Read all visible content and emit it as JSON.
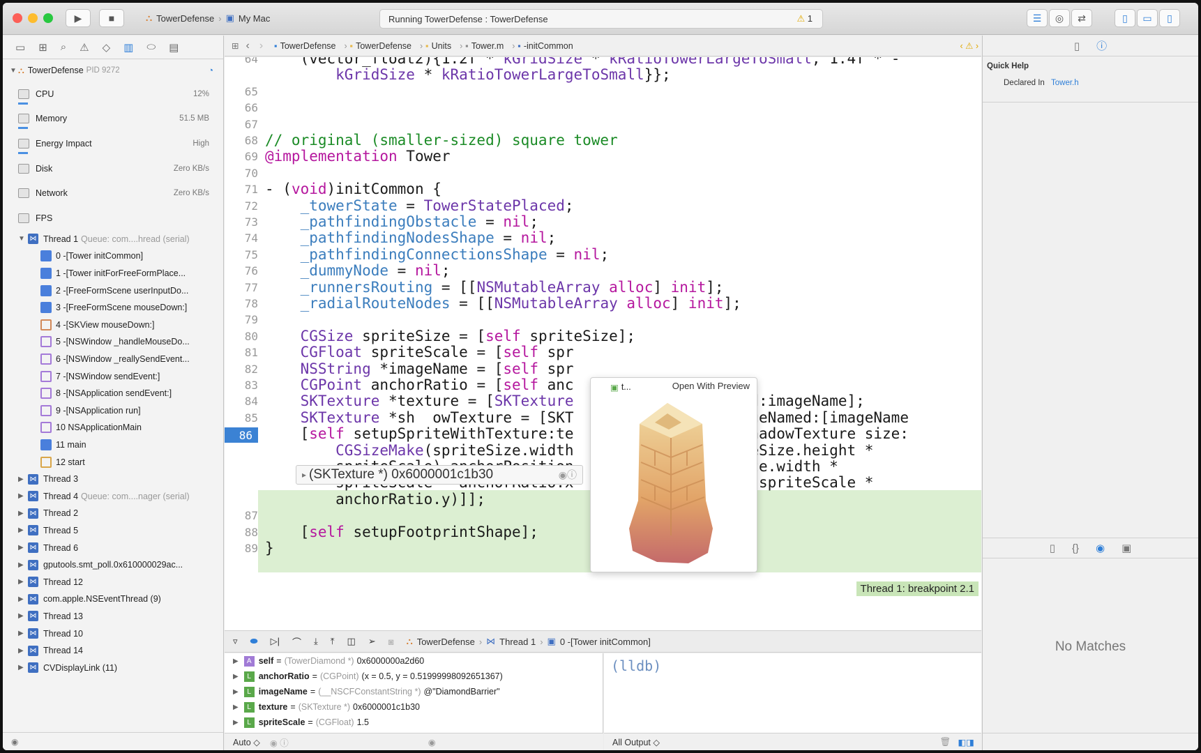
{
  "toolbar": {
    "scheme_name": "TowerDefense",
    "destination": "My Mac",
    "activity_text": "Running TowerDefense : TowerDefense",
    "warning_count": "1"
  },
  "navigator": {
    "process_name": "TowerDefense",
    "pid": "PID 9272",
    "gauges": [
      {
        "label": "CPU",
        "value": "12%"
      },
      {
        "label": "Memory",
        "value": "51.5 MB"
      },
      {
        "label": "Energy Impact",
        "value": "High"
      },
      {
        "label": "Disk",
        "value": "Zero KB/s"
      },
      {
        "label": "Network",
        "value": "Zero KB/s"
      },
      {
        "label": "FPS",
        "value": ""
      }
    ],
    "thread1": {
      "label": "Thread 1",
      "queue": "Queue: com....hread (serial)"
    },
    "frames": [
      "0 -[Tower initCommon]",
      "1 -[Tower initForFreeFormPlace...",
      "2 -[FreeFormScene userInputDo...",
      "3 -[FreeFormScene mouseDown:]",
      "4 -[SKView mouseDown:]",
      "5 -[NSWindow _handleMouseDo...",
      "6 -[NSWindow _reallySendEvent...",
      "7 -[NSWindow sendEvent:]",
      "8 -[NSApplication sendEvent:]",
      "9 -[NSApplication run]",
      "10 NSApplicationMain",
      "11 main",
      "12 start"
    ],
    "threads": [
      {
        "label": "Thread 3",
        "queue": ""
      },
      {
        "label": "Thread 4",
        "queue": "Queue: com....nager (serial)"
      },
      {
        "label": "Thread 2",
        "queue": ""
      },
      {
        "label": "Thread 5",
        "queue": ""
      },
      {
        "label": "Thread 6",
        "queue": ""
      },
      {
        "label": "gputools.smt_poll.0x610000029ac...",
        "queue": ""
      },
      {
        "label": "Thread 12",
        "queue": ""
      },
      {
        "label": "com.apple.NSEventThread (9)",
        "queue": ""
      },
      {
        "label": "Thread 13",
        "queue": ""
      },
      {
        "label": "Thread 10",
        "queue": ""
      },
      {
        "label": "Thread 14",
        "queue": ""
      },
      {
        "label": "CVDisplayLink (11)",
        "queue": ""
      }
    ]
  },
  "jumpbar": {
    "crumbs": [
      "TowerDefense",
      "TowerDefense",
      "Units",
      "Tower.m",
      "-initCommon"
    ]
  },
  "editor": {
    "lines": [
      {
        "n": "64",
        "t": "    (vector_float2){1.2f * kGridSize * kRatioTowerLargeToSmall, 1.4f * -"
      },
      {
        "n": "",
        "t": "        kGridSize * kRatioTowerLargeToSmall}};"
      },
      {
        "n": "65",
        "t": ""
      },
      {
        "n": "66",
        "t": ""
      },
      {
        "n": "67",
        "t": ""
      },
      {
        "n": "68",
        "t": "// original (smaller-sized) square tower"
      },
      {
        "n": "69",
        "t": "@implementation Tower"
      },
      {
        "n": "70",
        "t": ""
      },
      {
        "n": "71",
        "t": "- (void)initCommon {"
      },
      {
        "n": "72",
        "t": "    _towerState = TowerStatePlaced;"
      },
      {
        "n": "73",
        "t": "    _pathfindingObstacle = nil;"
      },
      {
        "n": "74",
        "t": "    _pathfindingNodesShape = nil;"
      },
      {
        "n": "75",
        "t": "    _pathfindingConnectionsShape = nil;"
      },
      {
        "n": "76",
        "t": "    _dummyNode = nil;"
      },
      {
        "n": "77",
        "t": "    _runnersRouting = [[NSMutableArray alloc] init];"
      },
      {
        "n": "78",
        "t": "    _radialRouteNodes = [[NSMutableArray alloc] init];"
      },
      {
        "n": "79",
        "t": ""
      },
      {
        "n": "80",
        "t": "    CGSize spriteSize = [self spriteSize];"
      },
      {
        "n": "81",
        "t": "    CGFloat spriteScale = [self spr"
      },
      {
        "n": "82",
        "t": "    NSString *imageName = [self spr"
      },
      {
        "n": "83",
        "t": "    CGPoint anchorRatio = [self anc"
      },
      {
        "n": "84",
        "t": "    SKTexture *texture = [SKTexture                 amed:imageName];"
      },
      {
        "n": "85",
        "t": "    SKTexture *sh  owTexture = [SKT                 ImageNamed:[imageName"
      },
      {
        "n": "86",
        "t": "    [self setupSpriteWithTexture:te                 e:shadowTexture size:"
      },
      {
        "n": "",
        "t": "        CGSizeMake(spriteSize.width                 riteSize.height *"
      },
      {
        "n": "",
        "t": "        spriteScale) anchorPosition                 eSize.width *"
      },
      {
        "n": "",
        "t": "        spriteScale * anchorRatio.x                 t * spriteScale *"
      },
      {
        "n": "",
        "t": "        anchorRatio.y)]];"
      },
      {
        "n": "87",
        "t": ""
      },
      {
        "n": "88",
        "t": "    [self setupFootprintShape];"
      },
      {
        "n": "89",
        "t": "}"
      }
    ],
    "breakpoint_label": "Thread 1: breakpoint 2.1",
    "tooltip": "(SKTexture *) 0x6000001c1b30",
    "popover_title": "t...",
    "popover_button": "Open With Preview"
  },
  "debugbar": {
    "process": "TowerDefense",
    "thread": "Thread 1",
    "frame": "0 -[Tower initCommon]"
  },
  "variables": [
    {
      "name": "self",
      "type": "(TowerDiamond *)",
      "value": "0x6000000a2d60",
      "kind": "A"
    },
    {
      "name": "anchorRatio",
      "type": "(CGPoint)",
      "value": "(x = 0.5, y = 0.51999998092651367)",
      "kind": "L"
    },
    {
      "name": "imageName",
      "type": "(__NSCFConstantString *)",
      "value": "@\"DiamondBarrier\"",
      "kind": "L"
    },
    {
      "name": "texture",
      "type": "(SKTexture *)",
      "value": "0x6000001c1b30",
      "kind": "L"
    },
    {
      "name": "spriteScale",
      "type": "(CGFloat)",
      "value": "1.5",
      "kind": "L"
    }
  ],
  "console": {
    "prompt": "(lldb)",
    "scope_selector": "Auto",
    "output_selector": "All Output"
  },
  "utilities": {
    "quick_help_title": "Quick Help",
    "declared_in_label": "Declared In",
    "declared_in_file": "Tower.h",
    "no_matches": "No Matches"
  },
  "colors": {
    "accent": "#2f7fd8",
    "breakpoint_line": "#dcefd2",
    "comment": "#1b8b26",
    "keyword": "#b5179e"
  }
}
